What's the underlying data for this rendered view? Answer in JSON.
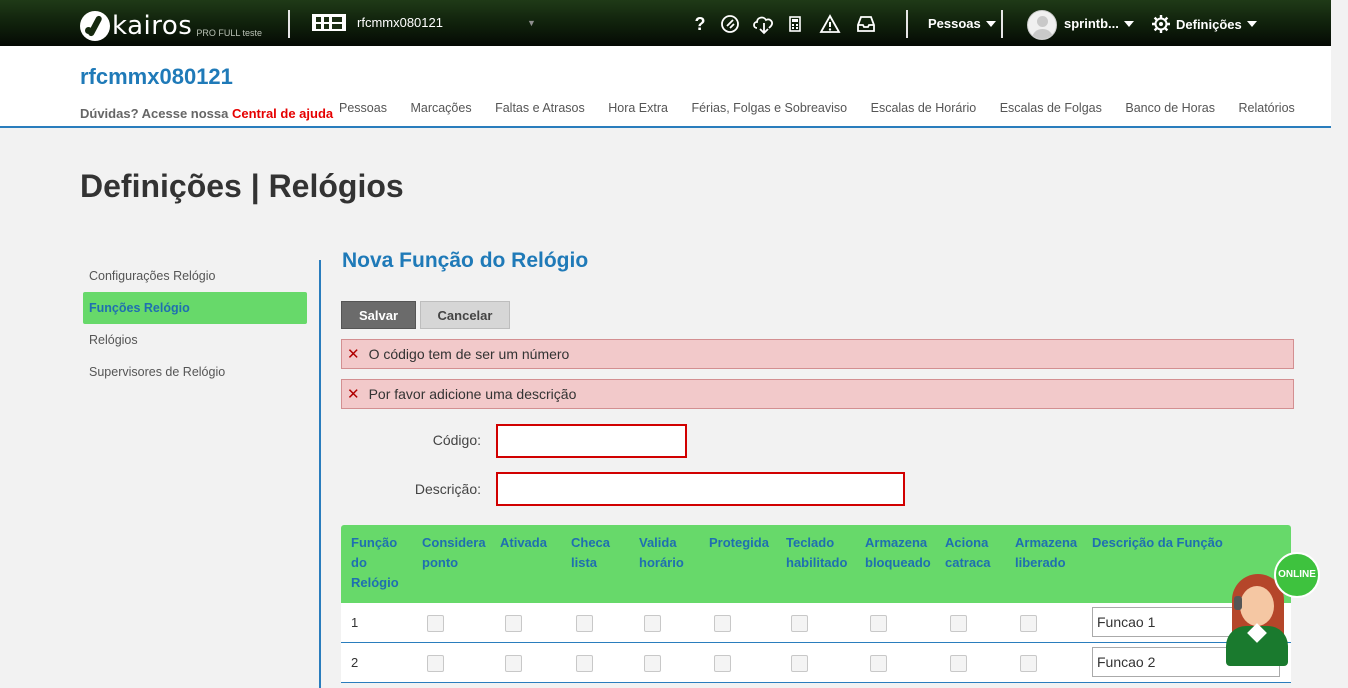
{
  "topbar": {
    "logo_text": "kairos",
    "logo_subtitle": "PRO FULL teste",
    "company_selector": "rfcmmx080121",
    "icons": [
      "help-icon",
      "ticket-icon",
      "cloud-download-icon",
      "calculator-icon",
      "warning-icon",
      "inbox-icon"
    ],
    "help_glyph": "?",
    "people_menu": "Pessoas",
    "user_menu": "sprintb...",
    "settings_menu": "Definições"
  },
  "header": {
    "company_title": "rfcmmx080121",
    "help_prefix": "Dúvidas? Acesse nossa",
    "help_link": "Central de ajuda",
    "nav": [
      "Pessoas",
      "Marcações",
      "Faltas e Atrasos",
      "Hora Extra",
      "Férias, Folgas e Sobreaviso",
      "Escalas de Horário",
      "Escalas de Folgas",
      "Banco de Horas",
      "Relatórios"
    ]
  },
  "page": {
    "title": "Definições | Relógios"
  },
  "sidebar": {
    "items": [
      {
        "label": "Configurações Relógio",
        "active": false
      },
      {
        "label": "Funções Relógio",
        "active": true
      },
      {
        "label": "Relógios",
        "active": false
      },
      {
        "label": "Supervisores de Relógio",
        "active": false
      }
    ]
  },
  "form": {
    "title": "Nova Função do Relógio",
    "save_label": "Salvar",
    "cancel_label": "Cancelar",
    "errors": [
      "O código tem de ser um número",
      "Por favor adicione uma descrição"
    ],
    "error_glyph": "✕",
    "code_label": "Código:",
    "code_value": "",
    "description_label": "Descrição:",
    "description_value": ""
  },
  "table": {
    "headers": [
      {
        "line1": "Função",
        "line2": "do",
        "line3": "Relógio"
      },
      {
        "line1": "Considera",
        "line2": "ponto",
        "line3": ""
      },
      {
        "line1": "Ativada",
        "line2": "",
        "line3": ""
      },
      {
        "line1": "Checa",
        "line2": "lista",
        "line3": ""
      },
      {
        "line1": "Valida",
        "line2": "horário",
        "line3": ""
      },
      {
        "line1": "Protegida",
        "line2": "",
        "line3": ""
      },
      {
        "line1": "Teclado",
        "line2": "habilitado",
        "line3": ""
      },
      {
        "line1": "Armazena",
        "line2": "bloqueado",
        "line3": ""
      },
      {
        "line1": "Aciona",
        "line2": "catraca",
        "line3": ""
      },
      {
        "line1": "Armazena",
        "line2": "liberado",
        "line3": ""
      },
      {
        "line1": "Descrição da Função",
        "line2": "",
        "line3": ""
      }
    ],
    "rows": [
      {
        "number": "1",
        "description": "Funcao 1"
      },
      {
        "number": "2",
        "description": "Funcao 2"
      }
    ]
  },
  "chat": {
    "status": "ONLINE"
  },
  "colors": {
    "topbar": "#0f1f0b",
    "accent_blue": "#1f7ab8",
    "active_green": "#67d96a",
    "error_red": "#d10000",
    "alert_bg": "#f2c9ca"
  }
}
